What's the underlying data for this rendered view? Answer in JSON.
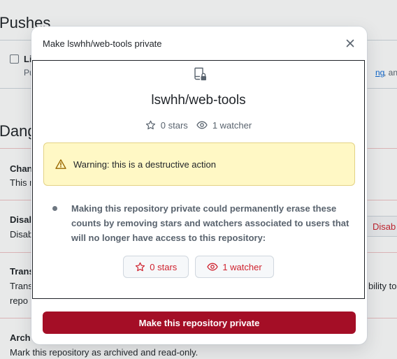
{
  "background": {
    "pushes_heading": "Pushes",
    "limit_label": "Li",
    "limit_desc": "Pu",
    "limit_link": "ng",
    "limit_desc_tail": ", and s",
    "danger_heading": "Dang",
    "change_title": "Chan",
    "change_desc": "This r",
    "disable_title": "Disal",
    "disable_desc": "Disab",
    "disable_button": "Disab",
    "transfer_title": "Trans",
    "transfer_desc": "Trans",
    "transfer_desc2": "repo",
    "transfer_tail": "bility to",
    "archive_title": "Arch",
    "archive_desc": "Mark this repository as archived and read-only."
  },
  "modal": {
    "title": "Make lswhh/web-tools private",
    "close_icon": "x-icon",
    "repo_icon": "repo-locked-icon",
    "repo_name": "lswhh/web-tools",
    "stars_label": "0 stars",
    "watchers_label": "1 watcher",
    "warning_text": "Warning: this is a destructive action",
    "impact_text": "Making this repository private could permanently erase these counts by removing stars and watchers associated to users that will no longer have access to this repository:",
    "stars_button": "0 stars",
    "watchers_button": "1 watcher",
    "confirm_button": "Make this repository private"
  },
  "colors": {
    "danger": "#cf222e",
    "confirm_bg": "#a40e26",
    "warning_bg": "#fff8c5",
    "warning_icon": "#9a6700"
  }
}
